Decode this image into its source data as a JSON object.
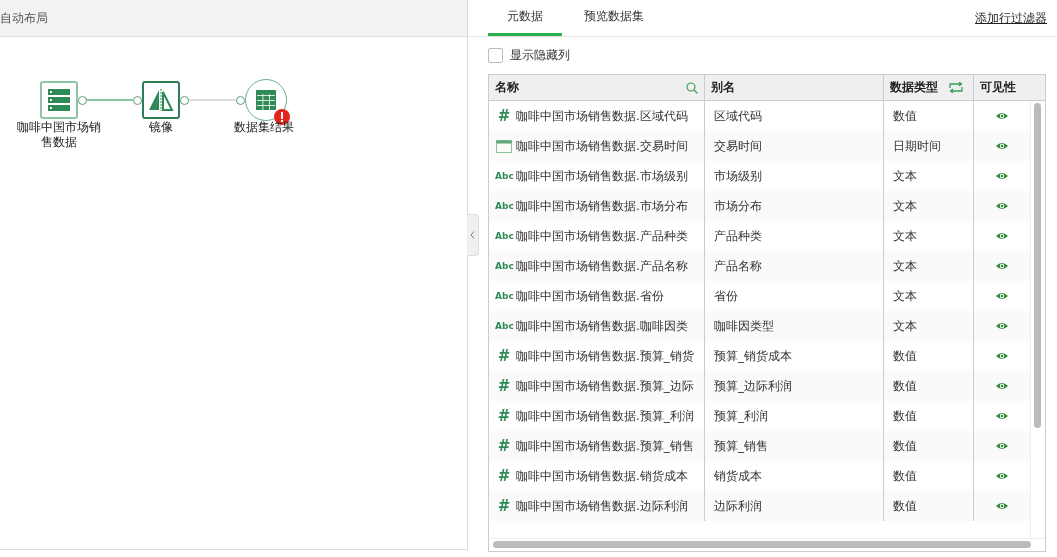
{
  "left_panel": {
    "toolbar_title": "自动布局",
    "nodes": [
      {
        "kind": "dataset",
        "label": "咖啡中国市场销售数据",
        "error": false
      },
      {
        "kind": "mirror",
        "label": "镜像",
        "error": false
      },
      {
        "kind": "result",
        "label": "数据集结果",
        "error": true
      }
    ],
    "links": [
      {
        "active": true
      },
      {
        "active": false
      }
    ]
  },
  "tabs": [
    {
      "label": "元数据",
      "selected": true
    },
    {
      "label": "预览数据集",
      "selected": false
    }
  ],
  "add_filter_link": "添加行过滤器",
  "show_hidden_columns": {
    "label": "显示隐藏列",
    "checked": false
  },
  "table": {
    "columns": [
      "名称",
      "别名",
      "数据类型",
      "可见性"
    ],
    "rows": [
      {
        "kind": "number",
        "type_mark": "#",
        "name": "咖啡中国市场销售数据.区域代码",
        "alias": "区域代码",
        "data_type": "数值",
        "visible": true
      },
      {
        "kind": "datetime",
        "name": "咖啡中国市场销售数据.交易时间",
        "alias": "交易时间",
        "data_type": "日期时间",
        "visible": true
      },
      {
        "kind": "text",
        "type_mark": "Abc",
        "name": "咖啡中国市场销售数据.市场级别",
        "alias": "市场级别",
        "data_type": "文本",
        "visible": true
      },
      {
        "kind": "text",
        "type_mark": "Abc",
        "name": "咖啡中国市场销售数据.市场分布",
        "alias": "市场分布",
        "data_type": "文本",
        "visible": true
      },
      {
        "kind": "text",
        "type_mark": "Abc",
        "name": "咖啡中国市场销售数据.产品种类",
        "alias": "产品种类",
        "data_type": "文本",
        "visible": true
      },
      {
        "kind": "text",
        "type_mark": "Abc",
        "name": "咖啡中国市场销售数据.产品名称",
        "alias": "产品名称",
        "data_type": "文本",
        "visible": true
      },
      {
        "kind": "text",
        "type_mark": "Abc",
        "name": "咖啡中国市场销售数据.省份",
        "alias": "省份",
        "data_type": "文本",
        "visible": true
      },
      {
        "kind": "text",
        "type_mark": "Abc",
        "name": "咖啡中国市场销售数据.咖啡因类",
        "alias": "咖啡因类型",
        "data_type": "文本",
        "visible": true
      },
      {
        "kind": "number",
        "type_mark": "#",
        "name": "咖啡中国市场销售数据.预算_销货",
        "alias": "预算_销货成本",
        "data_type": "数值",
        "visible": true
      },
      {
        "kind": "number",
        "type_mark": "#",
        "name": "咖啡中国市场销售数据.预算_边际",
        "alias": "预算_边际利润",
        "data_type": "数值",
        "visible": true
      },
      {
        "kind": "number",
        "type_mark": "#",
        "name": "咖啡中国市场销售数据.预算_利润",
        "alias": "预算_利润",
        "data_type": "数值",
        "visible": true
      },
      {
        "kind": "number",
        "type_mark": "#",
        "name": "咖啡中国市场销售数据.预算_销售",
        "alias": "预算_销售",
        "data_type": "数值",
        "visible": true
      },
      {
        "kind": "number",
        "type_mark": "#",
        "name": "咖啡中国市场销售数据.销货成本",
        "alias": "销货成本",
        "data_type": "数值",
        "visible": true
      },
      {
        "kind": "number",
        "type_mark": "#",
        "name": "咖啡中国市场销售数据.边际利润",
        "alias": "边际利润",
        "data_type": "数值",
        "visible": true
      }
    ]
  }
}
